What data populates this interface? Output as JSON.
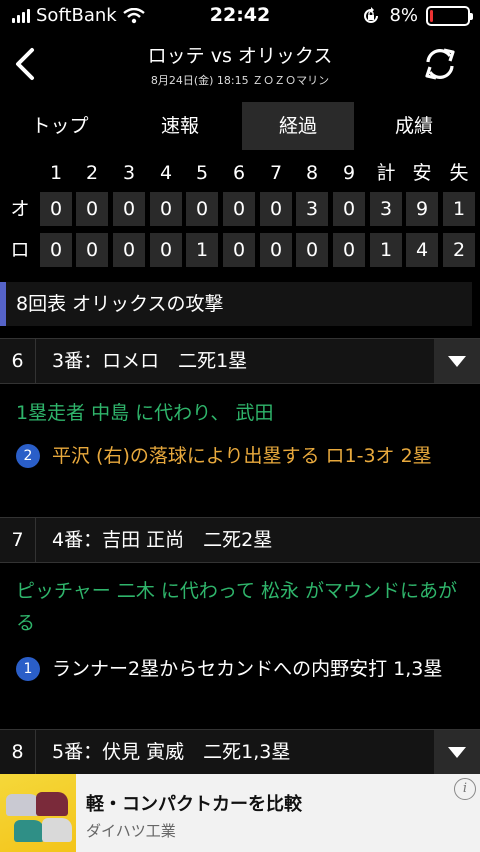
{
  "status": {
    "carrier": "SoftBank",
    "time": "22:42",
    "battery": "8%",
    "battery_level": 0.08,
    "icons": [
      "signal-bars-icon",
      "wifi-icon",
      "orientation-lock-icon",
      "battery-icon"
    ]
  },
  "header": {
    "title": "ロッテ vs オリックス",
    "subtitle": "8月24日(金) 18:15 ＺＯＺＯマリン",
    "icons": [
      "back-chevron-icon",
      "refresh-icon"
    ]
  },
  "tabs": [
    {
      "label": "トップ",
      "active": false
    },
    {
      "label": "速報",
      "active": false
    },
    {
      "label": "経過",
      "active": true
    },
    {
      "label": "成績",
      "active": false
    }
  ],
  "scoreboard": {
    "headers": [
      "1",
      "2",
      "3",
      "4",
      "5",
      "6",
      "7",
      "8",
      "9",
      "計",
      "安",
      "失"
    ],
    "rows": [
      {
        "team": "オ",
        "values": [
          "0",
          "0",
          "0",
          "0",
          "0",
          "0",
          "0",
          "3",
          "0",
          "3",
          "9",
          "1"
        ]
      },
      {
        "team": "ロ",
        "values": [
          "0",
          "0",
          "0",
          "0",
          "1",
          "0",
          "0",
          "0",
          "0",
          "1",
          "4",
          "2"
        ]
      }
    ]
  },
  "inning": {
    "label": "8回表 オリックスの攻撃"
  },
  "events": [
    {
      "num": "6",
      "desc": "3番：ロメロ　二死1塁",
      "expandable": true
    },
    {
      "note": "1塁走者 中島 に代わり、 武田"
    },
    {
      "badge": "2",
      "text": "平沢 (右)の落球により出塁する ロ1-3オ 2塁"
    },
    {
      "num": "7",
      "desc": "4番：吉田 正尚　二死2塁",
      "expandable": false
    },
    {
      "note": "ピッチャー 二木 に代わって 松永 がマウンドにあがる"
    },
    {
      "badge": "1",
      "text": "ランナー2塁からセカンドへの内野安打 1,3塁"
    },
    {
      "num": "8",
      "desc": "5番：伏見 寅威　二死1,3塁",
      "expandable": true
    }
  ],
  "ad": {
    "title": "軽・コンパクトカーを比較",
    "sponsor": "ダイハツ工業",
    "info_label": "i",
    "colors": {
      "thumb_bg": "#f3c41a"
    }
  },
  "colors": {
    "accent": "#5563c8",
    "green_note": "#2fb56b",
    "orange_play": "#e8a93d",
    "badge_blue": "#2a5ec8"
  }
}
